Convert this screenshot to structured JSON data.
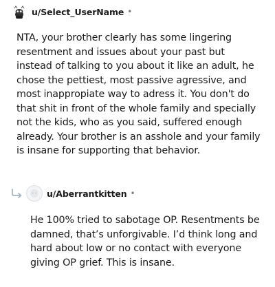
{
  "comments": [
    {
      "author": "u/Select_UserName",
      "separator": "•",
      "body": "NTA, your brother clearly has some lingering resentment and issues about your past but instead of talking to you about it like an adult, he chose the pettiest, most passive agressive, and most inappropiate way to adress it. You don't do that shit in front of the whole family and specially not the kids, who as you said, suffered enough already. Your brother is an asshole and your family is insane for supporting that behavior."
    },
    {
      "author": "u/Aberrantkitten",
      "separator": "•",
      "body": "He 100% tried to sabotage OP. Resentments be damned, that’s unforgivable. I’d think long and hard about low or no contact with everyone giving OP grief. This is insane."
    }
  ],
  "icons": {
    "avatar1": "snoo-avatar-icon",
    "reply": "reply-arrow-icon",
    "avatar2": "default-avatar-icon"
  },
  "colors": {
    "text": "#1a1a1b",
    "muted": "#7c7c7c",
    "reply_arrow": "#a8b4c4"
  }
}
